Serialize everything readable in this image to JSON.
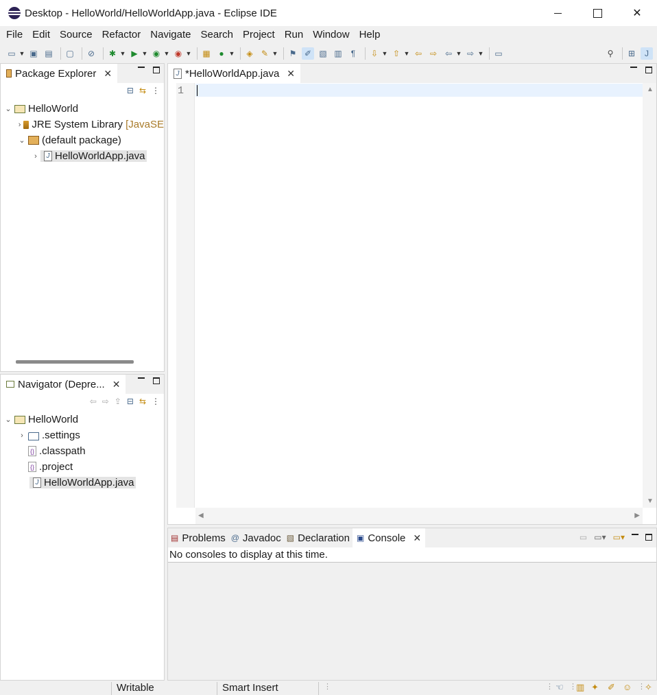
{
  "window": {
    "title": "Desktop - HelloWorld/HelloWorldApp.java - Eclipse IDE",
    "controls": [
      "minimize",
      "maximize",
      "close"
    ]
  },
  "menu": [
    "File",
    "Edit",
    "Source",
    "Refactor",
    "Navigate",
    "Search",
    "Project",
    "Run",
    "Window",
    "Help"
  ],
  "package_explorer": {
    "tab_label": "Package Explorer",
    "tree": {
      "project": "HelloWorld",
      "jre": "JRE System Library",
      "jre_suffix": "[JavaSE",
      "package": "(default package)",
      "file": "HelloWorldApp.java"
    }
  },
  "navigator": {
    "tab_label": "Navigator (Depre...",
    "tree": {
      "project": "HelloWorld",
      "settings": ".settings",
      "classpath": ".classpath",
      "project_file": ".project",
      "file": "HelloWorldApp.java"
    }
  },
  "editor": {
    "tab_label": "*HelloWorldApp.java",
    "line_number": "1"
  },
  "bottom_panel": {
    "tabs": {
      "problems": "Problems",
      "javadoc": "Javadoc",
      "declaration": "Declaration",
      "console": "Console"
    },
    "console_message": "No consoles to display at this time."
  },
  "status": {
    "writable": "Writable",
    "insert_mode": "Smart Insert"
  }
}
